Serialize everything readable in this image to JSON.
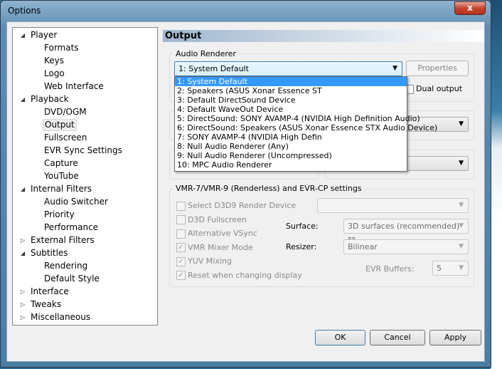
{
  "window": {
    "title": "Options",
    "close": "x"
  },
  "tree": [
    {
      "label": "Player",
      "level": 0,
      "expanded": true
    },
    {
      "label": "Formats",
      "level": 1
    },
    {
      "label": "Keys",
      "level": 1
    },
    {
      "label": "Logo",
      "level": 1
    },
    {
      "label": "Web Interface",
      "level": 1
    },
    {
      "label": "Playback",
      "level": 0,
      "expanded": true
    },
    {
      "label": "DVD/OGM",
      "level": 1
    },
    {
      "label": "Output",
      "level": 1,
      "selected": true
    },
    {
      "label": "Fullscreen",
      "level": 1
    },
    {
      "label": "EVR Sync Settings",
      "level": 1
    },
    {
      "label": "Capture",
      "level": 1
    },
    {
      "label": "YouTube",
      "level": 1
    },
    {
      "label": "Internal Filters",
      "level": 0,
      "expanded": true
    },
    {
      "label": "Audio Switcher",
      "level": 1
    },
    {
      "label": "Priority",
      "level": 1
    },
    {
      "label": "Performance",
      "level": 1
    },
    {
      "label": "External Filters",
      "level": 0
    },
    {
      "label": "Subtitles",
      "level": 0,
      "expanded": true
    },
    {
      "label": "Rendering",
      "level": 1
    },
    {
      "label": "Default Style",
      "level": 1
    },
    {
      "label": "Interface",
      "level": 0
    },
    {
      "label": "Tweaks",
      "level": 0
    },
    {
      "label": "Miscellaneous",
      "level": 0
    }
  ],
  "page": {
    "header": "Output",
    "audio": {
      "group": "Audio Renderer",
      "selected": "1: System Default",
      "properties": "Properties",
      "dual_output": "Dual output",
      "options": [
        "1: System Default",
        "2: Speakers (ASUS Xonar Essence ST",
        "3: Default DirectSound Device",
        "4: Default WaveOut Device",
        "5: DirectSound: SONY AVAMP-4 (NVIDIA High Definition Audio)",
        "6: DirectSound: Speakers (ASUS Xonar Essence STX Audio Device)",
        "7: SONY AVAMP-4 (NVIDIA High Defin",
        "8: Null Audio Renderer (Any)",
        "9: Null Audio Renderer (Uncompressed)",
        "10: MPC Audio Renderer"
      ]
    },
    "vmr": {
      "group": "VMR-7/VMR-9 (Renderless) and EVR-CP settings",
      "checks": [
        {
          "label": "Select D3D9 Render Device",
          "checked": false
        },
        {
          "label": "D3D Fullscreen",
          "checked": false
        },
        {
          "label": "Alternative VSync",
          "checked": false
        },
        {
          "label": "VMR Mixer Mode",
          "checked": true
        },
        {
          "label": "YUV Mixing",
          "checked": true
        },
        {
          "label": "Reset when changing display",
          "checked": true
        }
      ],
      "surface_label": "Surface:",
      "surface": "3D surfaces (recommended) **",
      "resizer_label": "Resizer:",
      "resizer": "Bilinear",
      "evr_label": "EVR Buffers:",
      "evr": "5"
    }
  },
  "buttons": {
    "ok": "OK",
    "cancel": "Cancel",
    "apply": "Apply"
  }
}
